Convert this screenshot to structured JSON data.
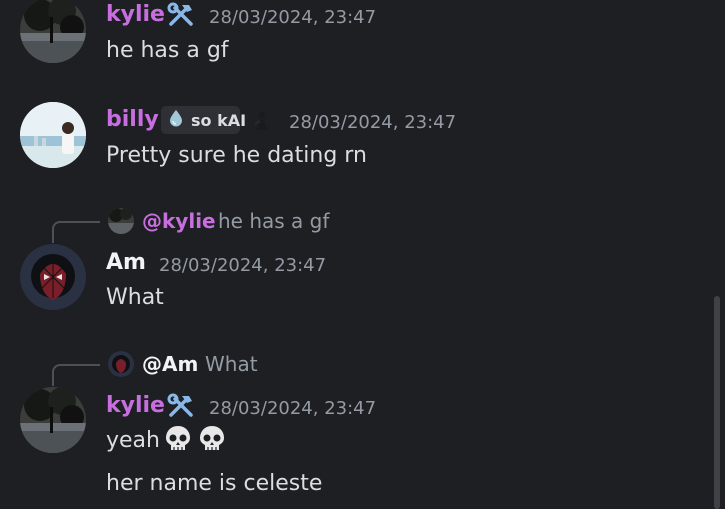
{
  "messages": [
    {
      "author": "kylie",
      "author_color": "#c86fe0",
      "timestamp": "28/03/2024, 23:47",
      "text": "he has a gf",
      "badge_icon": "hammer-wrench-icon"
    },
    {
      "author": "billy",
      "author_color": "#c86fe0",
      "timestamp": "28/03/2024, 23:47",
      "text": "Pretty sure he dating rn",
      "tag": {
        "icon": "droplet-icon",
        "label": "so kAI"
      },
      "extra_icon": "figure-icon"
    },
    {
      "reply": {
        "mention": "@kylie",
        "mention_color": "#c86fe0",
        "preview": "he has a gf"
      },
      "author": "Am",
      "author_color": "#f2f3f5",
      "timestamp": "28/03/2024, 23:47",
      "text": "What"
    },
    {
      "reply": {
        "mention": "@Am",
        "mention_color": "#f2f3f5",
        "preview": "What"
      },
      "author": "kylie",
      "author_color": "#c86fe0",
      "timestamp": "28/03/2024, 23:47",
      "text": "yeah",
      "emoji": [
        "skull-emoji",
        "skull-emoji"
      ],
      "badge_icon": "hammer-wrench-icon",
      "followup": "her name is celeste"
    }
  ]
}
